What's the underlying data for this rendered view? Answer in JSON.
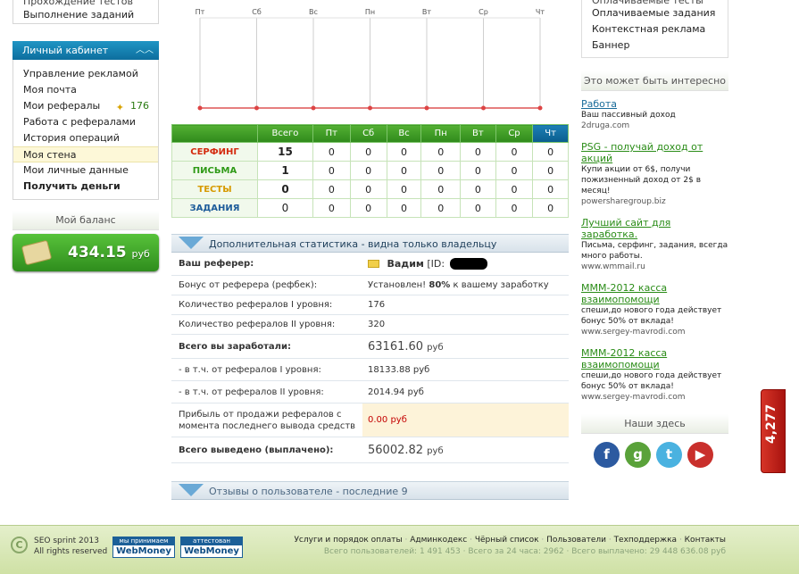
{
  "left": {
    "top_items": [
      "Прохождение тестов",
      "Выполнение заданий"
    ],
    "cabinet_title": "Личный кабинет",
    "cabinet_items": [
      {
        "label": "Управление рекламой"
      },
      {
        "label": "Моя почта"
      },
      {
        "label": "Мои рефералы",
        "count": "176"
      },
      {
        "label": "Работа с рефералами"
      },
      {
        "label": "История операций"
      },
      {
        "label": "Моя стена"
      },
      {
        "label": "Мои личные данные"
      },
      {
        "label": "Получить деньги"
      }
    ],
    "balance_title": "Мой баланс",
    "balance_value": "434.15",
    "balance_currency": "руб"
  },
  "chart_data": {
    "type": "line",
    "categories": [
      "Пт",
      "Сб",
      "Вс",
      "Пн",
      "Вт",
      "Ср",
      "Чт"
    ],
    "series": [
      {
        "values": [
          0,
          0,
          0,
          0,
          0,
          0,
          0
        ]
      }
    ],
    "ylim": [
      0,
      1
    ],
    "grid": true
  },
  "stats": {
    "headers": [
      "",
      "Всего",
      "Пт",
      "Сб",
      "Вс",
      "Пн",
      "Вт",
      "Ср",
      "Чт"
    ],
    "rows": [
      {
        "label": "СЕРФИНГ",
        "color": "#d42a0e",
        "total": "15",
        "days": [
          "0",
          "0",
          "0",
          "0",
          "0",
          "0",
          "0"
        ]
      },
      {
        "label": "ПИСЬМА",
        "color": "#2f9a17",
        "total": "1",
        "days": [
          "0",
          "0",
          "0",
          "0",
          "0",
          "0",
          "0"
        ]
      },
      {
        "label": "ТЕСТЫ",
        "color": "#d79a00",
        "total": "0",
        "days": [
          "0",
          "0",
          "0",
          "0",
          "0",
          "0",
          "0"
        ]
      },
      {
        "label": "ЗАДАНИЯ",
        "color": "#1e5c9a",
        "total": "0",
        "days": [
          "0",
          "0",
          "0",
          "0",
          "0",
          "0",
          "0"
        ]
      }
    ]
  },
  "extra": {
    "title": "Дополнительная статистика - видна только владельцу",
    "referer_label": "Ваш реферер:",
    "referer_name": "Вадим",
    "referer_id_prefix": "[ID:",
    "bonus_label": "Бонус от реферера (рефбек):",
    "bonus_prefix": "Установлен!",
    "bonus_percent": "80%",
    "bonus_suffix": "к вашему заработку",
    "lvl1_label": "Количество рефералов I уровня:",
    "lvl1_value": "176",
    "lvl2_label": "Количество рефералов II уровня:",
    "lvl2_value": "320",
    "earned_label": "Всего вы заработали:",
    "earned_value": "63161.60",
    "earned_unit": "руб",
    "from_l1_label": "- в т.ч. от рефералов I уровня:",
    "from_l1_value": "18133.88 руб",
    "from_l2_label": "- в т.ч. от рефералов II уровня:",
    "from_l2_value": "2014.94 руб",
    "profit_label": "Прибыль от продажи рефералов с момента последнего вывода средств",
    "profit_value": "0.00 руб",
    "withdrawn_label": "Всего выведено (выплачено):",
    "withdrawn_value": "56002.82",
    "withdrawn_unit": "руб"
  },
  "reviews_title": "Отзывы о пользователе - последние 9",
  "right": {
    "top_links": [
      "Оплачиваемые тесты",
      "Оплачиваемые задания",
      "Контекстная реклама",
      "Баннер"
    ],
    "interesting_title": "Это может быть интересно",
    "ads": [
      {
        "title": "Работа",
        "desc": "Ваш пассивный доход",
        "url": "2druga.com",
        "color": "#1a6c9a"
      },
      {
        "title": "PSG - получай доход от акций",
        "desc": "Купи акции от 6$, получи пожизненный доход от 2$ в месяц!",
        "url": "powersharegroup.biz",
        "color": "#2a8c17"
      },
      {
        "title": "Лучший сайт для заработка.",
        "desc": "Письма, серфинг, задания, всегда много работы.",
        "url": "www.wmmail.ru",
        "color": "#2a8c17"
      },
      {
        "title": "МММ-2012 касса взаимопомощи",
        "desc": "спеши,до нового года действует бонус 50% от вклада!",
        "url": "www.sergey-mavrodi.com",
        "color": "#2a8c17"
      },
      {
        "title": "МММ-2012 касса взаимопомощи",
        "desc": "спеши,до нового года действует бонус 50% от вклада!",
        "url": "www.sergey-mavrodi.com",
        "color": "#2a8c17"
      }
    ],
    "social_title": "Наши здесь",
    "social": [
      {
        "icon": "facebook-icon",
        "glyph": "f",
        "color": "#2c5aa0"
      },
      {
        "icon": "google-icon",
        "glyph": "g",
        "color": "#5aa23a"
      },
      {
        "icon": "twitter-icon",
        "glyph": "t",
        "color": "#4ab2e0"
      },
      {
        "icon": "youtube-icon",
        "glyph": "▶",
        "color": "#c9302c"
      }
    ]
  },
  "badge": "4,277",
  "footer": {
    "copyright_line1": "SEO sprint 2013",
    "copyright_line2": "All rights reserved",
    "wm1_top": "мы принимаем",
    "wm1_bottom": "WebMoney",
    "wm2_top": "аттестован",
    "wm2_bottom": "WebMoney",
    "links": [
      "Услуги и порядок оплаты",
      "Админкодекс",
      "Чёрный список",
      "Пользователи",
      "Техподдержка",
      "Контакты"
    ],
    "stats": "Всего пользователей: 1 491 453 · Всего за 24 часа: 2962 · Всего выплачено: 29 448 636.08 руб"
  }
}
